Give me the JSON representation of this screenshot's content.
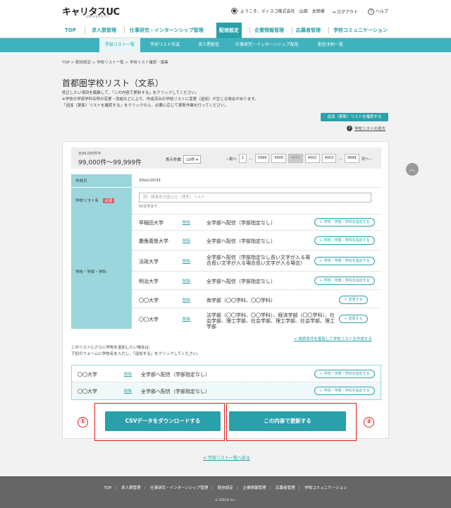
{
  "header": {
    "logo": "キャリタスUC",
    "logo_sub": "UNIVERSITY",
    "greeting": "ようこそ、ディスコ株式会社　山田　太郎様",
    "logout": "ログアウト",
    "help": "ヘルプ"
  },
  "nav": [
    "TOP",
    "求人票管理",
    "仕事研究・インターンシップ管理",
    "配信設定",
    "企業情報管理",
    "応募者管理",
    "学校コミュニケーション"
  ],
  "subnav": [
    "学校リスト一覧",
    "学校リスト作成",
    "求人票配信",
    "仕事研究・インターンシップ配信",
    "配信予約一覧"
  ],
  "breadcrumb": "TOP > 配信設定 > 学校リスト一覧 > 学校リスト確認・編集",
  "page_title": "首都圏学校リスト（文系）",
  "desc": [
    "修正したい項目を編集して、「この内容で更新する」をクリックしてください。",
    "※学校の学部学科名称の変更・改組などにより、作成済みの学校リストに変更（追加）が生じる場合があります。",
    "「追加（更新）リストを確認する」をクリックの上、必要に応じて更新作業を行ってください。"
  ],
  "confirm_button": "追加（更新）リストを確認する",
  "help_link": "学校リストの見方",
  "pager": {
    "total_label": "全99,000件中",
    "range": "99,000件～99,999件",
    "perpage_label": "表示件数",
    "perpage_value": "10件",
    "prev": "前へ",
    "next": "次へ",
    "pages": [
      "1",
      "3999",
      "4000",
      "4001",
      "4002",
      "4003",
      "9999"
    ],
    "current": "4001"
  },
  "form": {
    "date_label": "作成日",
    "date_value": "20xx/10/31",
    "name_label": "学校リスト名",
    "required": "必須",
    "name_placeholder": "例）関東地方国公立（理系）リスト",
    "name_note": "50文字まで",
    "schools_label": "学校・学部・学科",
    "delete": "削除",
    "specify_btn": "学校・学部・学科を指定する",
    "change_btn": "変更する"
  },
  "schools": [
    {
      "name": "早稲田大学",
      "dept": "全学部へ配信（学部指定なし）"
    },
    {
      "name": "慶應義塾大学",
      "dept": "全学部へ配信（学部指定なし）"
    },
    {
      "name": "法政大学",
      "dept": "全学部へ配信（学部指定なし長い文字が入る場合長い文字が入る場合長い文字が入る場合）"
    },
    {
      "name": "明治大学",
      "dept": "全学部へ配信（学部指定なし）"
    },
    {
      "name": "〇〇大学",
      "dept": "商学部（〇〇学科、〇〇学科）"
    },
    {
      "name": "〇〇大学",
      "dept": "法学部（〇〇学科、〇〇学科）、経済学部（〇〇学科）、社会学部、理工学部、社会学部、理工学部、社会学部、理工学部"
    }
  ],
  "copy_link": "検索条件を複製して学校リストを作成する",
  "add_note": [
    "このリストにさらに学校を追加したい場合は、",
    "下記のフォームに学校名を入力し、「追加する」をクリックしてください。"
  ],
  "add_schools": [
    {
      "name": "〇〇大学",
      "dept": "全学部へ配信（学部指定なし）"
    },
    {
      "name": "〇〇大学",
      "dept": "全学部へ配信（学部指定なし）"
    }
  ],
  "buttons": {
    "csv": "CSVデータをダウンロードする",
    "update": "この内容で更新する"
  },
  "markers": [
    "①",
    "②"
  ],
  "back_link": "学校リスト一覧へ戻る",
  "footer_nav": [
    "TOP",
    "求人票管理",
    "仕事研究・インターンシップ管理",
    "配信設定",
    "企業情報管理",
    "応募者管理",
    "学校コミュニケーション"
  ],
  "copyright": "© DISCO Inc.",
  "colors": {
    "accent": "#2aa0aa",
    "label_bg": "#9ad6dc",
    "required": "#e8556a",
    "marker": "#e02020"
  }
}
